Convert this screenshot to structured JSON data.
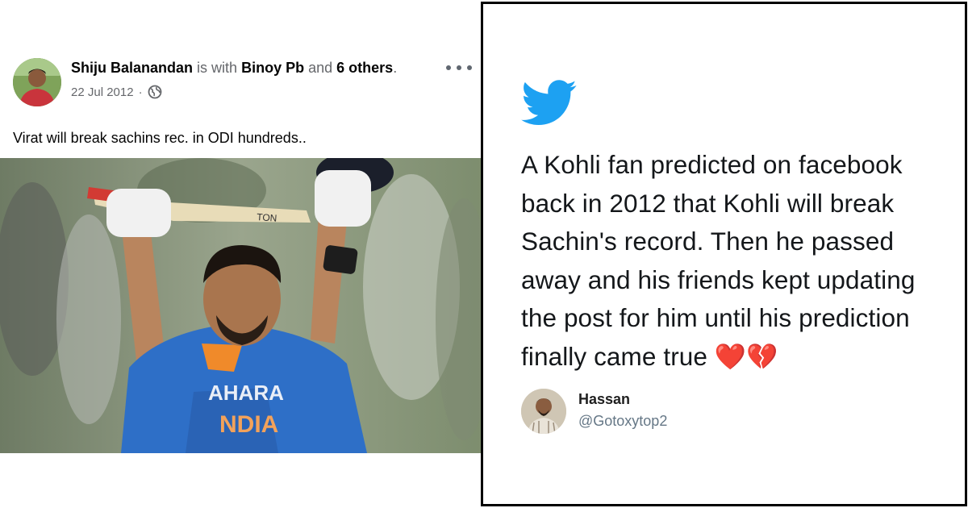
{
  "fb_post": {
    "author": "Shiju Balanandan",
    "with_text": "is with",
    "tagged": "Binoy Pb",
    "and_text": "and",
    "others": "6 others",
    "period": ".",
    "date": "22 Jul 2012",
    "date_sep": "·",
    "privacy_icon": "globe-icon",
    "more_icon": "more-options-icon",
    "text": "Virat will break sachins rec. in ODI hundreds..",
    "photo_jersey_top": "AHARA",
    "photo_jersey_bottom": "NDIA",
    "photo_bat_label": "TON"
  },
  "tweet": {
    "brand_icon": "twitter-bird-icon",
    "brand_color": "#1da1f2",
    "text": "A Kohli fan predicted on facebook back in 2012 that Kohli will break Sachin's record. Then he passed away and his friends kept updating the post for him until his prediction finally came true ❤️💔",
    "user_name": "Hassan",
    "user_handle": "@Gotoxytop2"
  }
}
